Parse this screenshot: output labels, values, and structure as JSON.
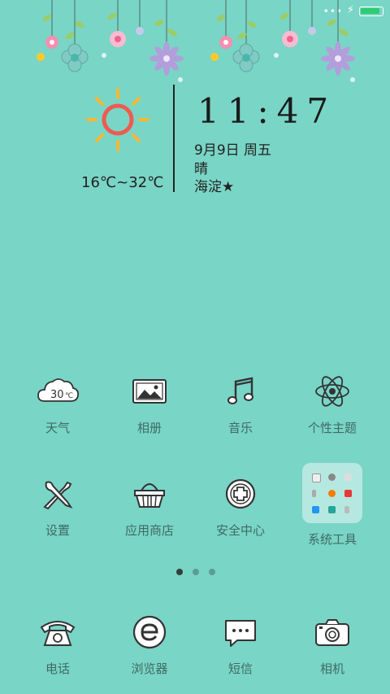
{
  "status_bar": {
    "signal_dots": "•••",
    "battery_percent": 90,
    "charging": true
  },
  "widget": {
    "time": "11:47",
    "date": "9月9日 周五",
    "condition": "晴",
    "location": "海淀★",
    "temperature": "16℃~32℃"
  },
  "apps": {
    "row1": [
      {
        "label": "天气",
        "icon": "weather-cloud-icon",
        "icon_text": "30",
        "icon_unit": "℃"
      },
      {
        "label": "相册",
        "icon": "gallery-icon"
      },
      {
        "label": "音乐",
        "icon": "music-note-icon"
      },
      {
        "label": "个性主题",
        "icon": "atom-icon"
      }
    ],
    "row2": [
      {
        "label": "设置",
        "icon": "tools-icon"
      },
      {
        "label": "应用商店",
        "icon": "shopping-basket-icon"
      },
      {
        "label": "安全中心",
        "icon": "shield-plus-icon"
      },
      {
        "label": "系统工具",
        "icon": "folder-icon"
      }
    ]
  },
  "page_indicator": {
    "count": 3,
    "active": 0
  },
  "dock": [
    {
      "label": "电话",
      "icon": "telephone-icon"
    },
    {
      "label": "浏览器",
      "icon": "browser-e-icon"
    },
    {
      "label": "短信",
      "icon": "message-bubble-icon"
    },
    {
      "label": "相机",
      "icon": "camera-icon"
    }
  ],
  "colors": {
    "background": "#79d5c6",
    "sun_ring": "#f05a4f",
    "sun_rays": "#f7b733",
    "battery_fill": "#2ecc71"
  }
}
